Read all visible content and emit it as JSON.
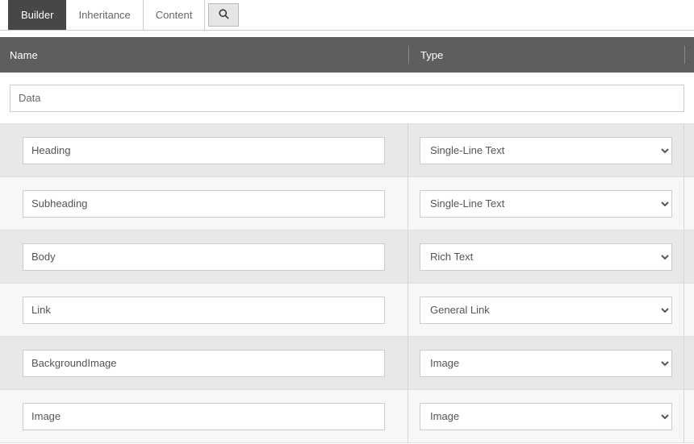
{
  "tabs": {
    "builder": "Builder",
    "inheritance": "Inheritance",
    "content": "Content"
  },
  "columns": {
    "name": "Name",
    "type": "Type"
  },
  "section": {
    "value": "Data"
  },
  "typeOptions": [
    "Single-Line Text",
    "Rich Text",
    "General Link",
    "Image"
  ],
  "fields": [
    {
      "name": "Heading",
      "type": "Single-Line Text"
    },
    {
      "name": "Subheading",
      "type": "Single-Line Text"
    },
    {
      "name": "Body",
      "type": "Rich Text"
    },
    {
      "name": "Link",
      "type": "General Link"
    },
    {
      "name": "BackgroundImage",
      "type": "Image"
    },
    {
      "name": "Image",
      "type": "Image"
    }
  ]
}
